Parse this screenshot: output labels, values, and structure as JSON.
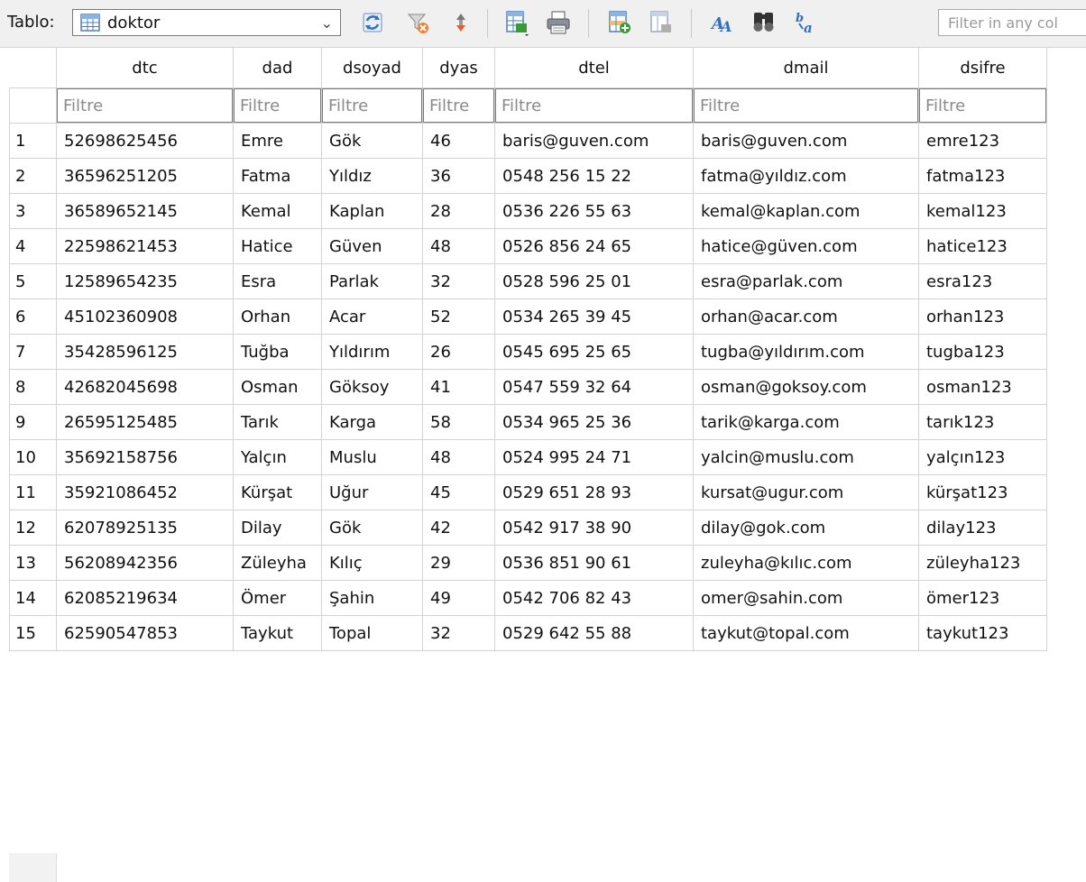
{
  "toolbar": {
    "table_label": "Tablo:",
    "table_selected": "doktor",
    "filter_any_placeholder": "Filter in any col"
  },
  "grid": {
    "columns": [
      "dtc",
      "dad",
      "dsoyad",
      "dyas",
      "dtel",
      "dmail",
      "dsifre"
    ],
    "filter_placeholder": "Filtre",
    "rows": [
      {
        "n": "1",
        "dtc": "52698625456",
        "dad": "Emre",
        "dsoyad": "Gök",
        "dyas": "46",
        "dtel": "baris@guven.com",
        "dmail": "baris@guven.com",
        "dsifre": "emre123"
      },
      {
        "n": "2",
        "dtc": "36596251205",
        "dad": "Fatma",
        "dsoyad": "Yıldız",
        "dyas": "36",
        "dtel": "0548 256 15 22",
        "dmail": "fatma@yıldız.com",
        "dsifre": "fatma123"
      },
      {
        "n": "3",
        "dtc": "36589652145",
        "dad": "Kemal",
        "dsoyad": "Kaplan",
        "dyas": "28",
        "dtel": "0536 226 55 63",
        "dmail": "kemal@kaplan.com",
        "dsifre": "kemal123"
      },
      {
        "n": "4",
        "dtc": "22598621453",
        "dad": "Hatice",
        "dsoyad": "Güven",
        "dyas": "48",
        "dtel": "0526 856 24 65",
        "dmail": "hatice@güven.com",
        "dsifre": "hatice123"
      },
      {
        "n": "5",
        "dtc": "12589654235",
        "dad": "Esra",
        "dsoyad": "Parlak",
        "dyas": "32",
        "dtel": "0528 596 25 01",
        "dmail": "esra@parlak.com",
        "dsifre": "esra123"
      },
      {
        "n": "6",
        "dtc": "45102360908",
        "dad": "Orhan",
        "dsoyad": "Acar",
        "dyas": "52",
        "dtel": "0534 265 39 45",
        "dmail": "orhan@acar.com",
        "dsifre": "orhan123"
      },
      {
        "n": "7",
        "dtc": "35428596125",
        "dad": "Tuğba",
        "dsoyad": "Yıldırım",
        "dyas": "26",
        "dtel": "0545 695 25 65",
        "dmail": "tugba@yıldırım.com",
        "dsifre": "tugba123"
      },
      {
        "n": "8",
        "dtc": "42682045698",
        "dad": "Osman",
        "dsoyad": "Göksoy",
        "dyas": "41",
        "dtel": "0547 559 32 64",
        "dmail": "osman@goksoy.com",
        "dsifre": "osman123"
      },
      {
        "n": "9",
        "dtc": "26595125485",
        "dad": "Tarık",
        "dsoyad": "Karga",
        "dyas": "58",
        "dtel": "0534 965 25 36",
        "dmail": "tarik@karga.com",
        "dsifre": "tarık123"
      },
      {
        "n": "10",
        "dtc": "35692158756",
        "dad": "Yalçın",
        "dsoyad": "Muslu",
        "dyas": "48",
        "dtel": "0524 995 24 71",
        "dmail": "yalcin@muslu.com",
        "dsifre": "yalçın123"
      },
      {
        "n": "11",
        "dtc": "35921086452",
        "dad": "Kürşat",
        "dsoyad": "Uğur",
        "dyas": "45",
        "dtel": "0529 651 28 93",
        "dmail": "kursat@ugur.com",
        "dsifre": "kürşat123"
      },
      {
        "n": "12",
        "dtc": "62078925135",
        "dad": "Dilay",
        "dsoyad": "Gök",
        "dyas": "42",
        "dtel": "0542 917 38 90",
        "dmail": "dilay@gok.com",
        "dsifre": "dilay123"
      },
      {
        "n": "13",
        "dtc": "56208942356",
        "dad": "Züleyha",
        "dsoyad": "Kılıç",
        "dyas": "29",
        "dtel": "0536 851 90 61",
        "dmail": "zuleyha@kılıc.com",
        "dsifre": "züleyha123"
      },
      {
        "n": "14",
        "dtc": "62085219634",
        "dad": "Ömer",
        "dsoyad": "Şahin",
        "dyas": "49",
        "dtel": "0542 706 82 43",
        "dmail": "omer@sahin.com",
        "dsifre": "ömer123"
      },
      {
        "n": "15",
        "dtc": "62590547853",
        "dad": "Taykut",
        "dsoyad": "Topal",
        "dyas": "32",
        "dtel": "0529 642 55 88",
        "dmail": "taykut@topal.com",
        "dsifre": "taykut123"
      }
    ]
  },
  "icons": {
    "refresh": "refresh-icon",
    "clear_filters": "clear-filters-icon",
    "sort": "sort-icon",
    "save_table": "save-table-icon",
    "print": "print-icon",
    "new_record": "new-record-icon",
    "delete_record": "delete-record-icon",
    "font": "font-icon",
    "find": "find-icon",
    "find_replace": "find-replace-icon"
  },
  "colors": {
    "toolbar_bg": "#f0f0f0",
    "grid_line": "#d3d3d3",
    "icon_blue": "#2f6fc4",
    "icon_green": "#3a9a3a",
    "icon_red": "#d04030"
  }
}
